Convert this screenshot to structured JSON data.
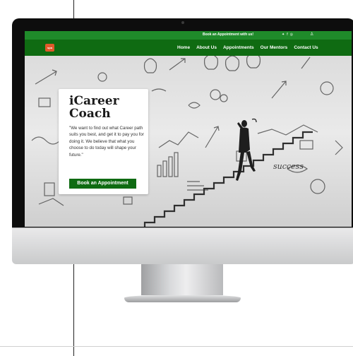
{
  "site": {
    "topbar": {
      "cta_text": "Book an Appointment with us!",
      "social_icons": [
        "twitter-icon",
        "facebook-icon",
        "instagram-icon"
      ],
      "account_icon": "user-icon"
    },
    "logo_text": "spa",
    "nav": {
      "items": [
        "Home",
        "About Us",
        "Appointments",
        "Our Mentors",
        "Contact Us"
      ]
    },
    "hero": {
      "title": "iCareer Coach",
      "description": "\"We want to find out what Career path suits you best, and get it to pay you for doing it. We believe that what you choose to do today will shape your future.\"",
      "button_label": "Book an Appointment",
      "background_word": "success"
    },
    "colors": {
      "topbar": "#1f8a2a",
      "nav": "#0f6b12",
      "button": "#0f6b12",
      "logo": "#e0592a"
    }
  }
}
